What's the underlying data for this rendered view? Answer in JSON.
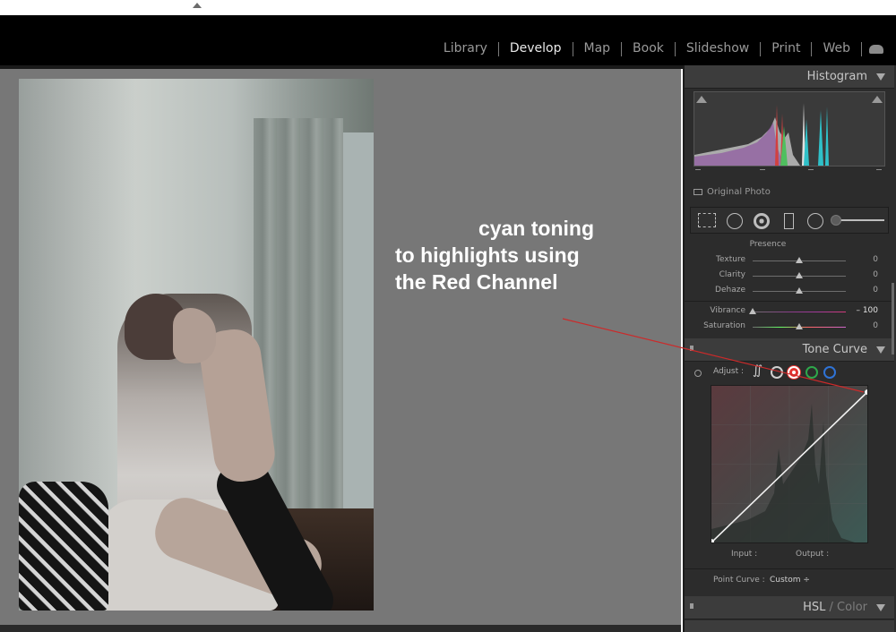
{
  "modules": [
    {
      "label": "Library",
      "active": false
    },
    {
      "label": "Develop",
      "active": true
    },
    {
      "label": "Map",
      "active": false
    },
    {
      "label": "Book",
      "active": false
    },
    {
      "label": "Slideshow",
      "active": false
    },
    {
      "label": "Print",
      "active": false
    },
    {
      "label": "Web",
      "active": false
    }
  ],
  "annotation": {
    "line1": "cyan toning",
    "line2": "to highlights using",
    "line3": "the Red Channel",
    "color": "#ffffff",
    "arrow_color": "#cc2a2a"
  },
  "histogram": {
    "title": "Histogram",
    "original_photo_label": "Original Photo"
  },
  "presence": {
    "title": "Presence",
    "sliders": [
      {
        "name": "Texture",
        "value": "0",
        "level": 0.5
      },
      {
        "name": "Clarity",
        "value": "0",
        "level": 0.5
      },
      {
        "name": "Dehaze",
        "value": "0",
        "level": 0.5
      },
      {
        "name": "Vibrance",
        "value": "– 100",
        "level": 0.0
      },
      {
        "name": "Saturation",
        "value": "0",
        "level": 0.5
      }
    ]
  },
  "tone_curve": {
    "title": "Tone Curve",
    "adjust_label": "Adjust :",
    "input_label": "Input :",
    "output_label": "Output :",
    "point_curve_label": "Point Curve :",
    "point_curve_value": "Custom ÷",
    "selected_channel": "red",
    "channel_colors": {
      "red": "#e3322f",
      "green": "#2ea84b",
      "blue": "#2f73d6"
    }
  },
  "hsl": {
    "title_main": "HSL",
    "title_sep": " / ",
    "title_alt": "Color"
  }
}
